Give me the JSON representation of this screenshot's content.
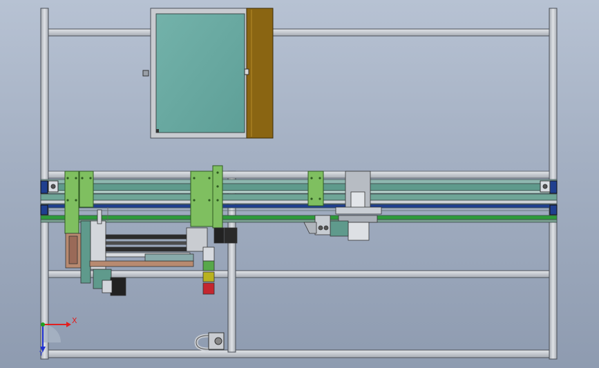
{
  "colors": {
    "background_top": "#b7c2d3",
    "background_bottom": "#8e9bb0",
    "frame_fill": "#c9ccd1",
    "frame_edge": "#4a4f57",
    "panel_glass": "#69a9a2",
    "panel_door": "#8a6512",
    "bracket_green": "#7fbf60",
    "rail_teal": "#5f9a8c",
    "rail_green": "#2e9b3a",
    "rail_blue": "#1f3f8f",
    "light_red": "#c4262e",
    "light_yellow": "#b9b21f",
    "light_green": "#58a84a",
    "axis_x": "#e02020",
    "axis_y": "#2030d0",
    "axis_z": "#20a020"
  },
  "triad": {
    "x_label": "X",
    "y_label": "Y"
  }
}
